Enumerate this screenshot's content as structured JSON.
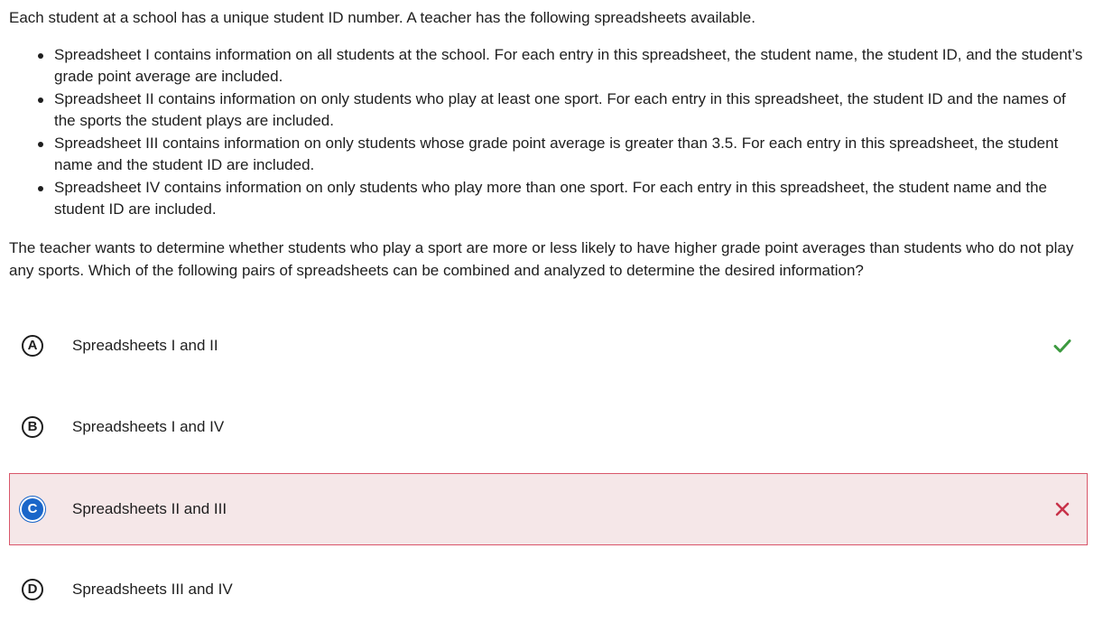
{
  "question": {
    "intro": "Each student at a school has a unique student ID number. A teacher has the following spreadsheets available.",
    "bullets": [
      "Spreadsheet I contains information on all students at the school. For each entry in this spreadsheet, the student name, the student ID, and the student’s grade point average are included.",
      "Spreadsheet II contains information on only students who play at least one sport. For each entry in this spreadsheet, the student ID and the names of the sports the student plays are included.",
      "Spreadsheet III contains information on only students whose grade point average is greater than 3.5. For each entry in this spreadsheet, the student name and the student ID are included.",
      "Spreadsheet IV contains information on only students who play more than one sport. For each entry in this spreadsheet, the student name and the student ID are included."
    ],
    "prompt": "The teacher wants to determine whether students who play a sport are more or less likely to have higher grade point averages than students who do not play any sports. Which of the following pairs of spreadsheets can be combined and analyzed to determine the desired information?"
  },
  "choices": [
    {
      "letter": "A",
      "text": "Spreadsheets I and II",
      "status": "correct",
      "mark_icon": "check-icon"
    },
    {
      "letter": "B",
      "text": "Spreadsheets I and IV",
      "status": "none",
      "mark_icon": ""
    },
    {
      "letter": "C",
      "text": "Spreadsheets II and III",
      "status": "selected-incorrect",
      "mark_icon": "x-icon"
    },
    {
      "letter": "D",
      "text": "Spreadsheets III and IV",
      "status": "none",
      "mark_icon": ""
    }
  ],
  "colors": {
    "correct": "#3d9a40",
    "incorrect": "#c8324a",
    "selected_fill": "#1a66c9",
    "selected_background": "#f5e7e8",
    "selected_border": "#d9566a"
  }
}
